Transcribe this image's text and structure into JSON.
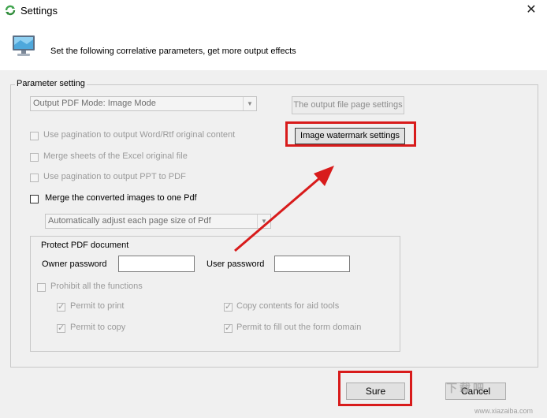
{
  "window": {
    "title": "Settings",
    "close_glyph": "✕"
  },
  "header": {
    "text": "Set the following correlative parameters, get more output effects"
  },
  "parameter_group": {
    "label": "Parameter setting",
    "output_mode": "Output PDF Mode: Image Mode",
    "output_page_settings_btn": "The output file page settings",
    "image_watermark_btn": "Image watermark settings",
    "options": {
      "word_pagination": "Use pagination to output Word/Rtf original content",
      "excel_merge": "Merge sheets of the Excel original file",
      "ppt_pagination": "Use pagination to output PPT to PDF",
      "merge_images": "Merge the converted images to one Pdf"
    },
    "page_size_select": "Automatically adjust each page size of Pdf"
  },
  "protect_group": {
    "label": "Protect PDF document",
    "owner_password_label": "Owner password",
    "user_password_label": "User password",
    "prohibit_all": "Prohibit all the functions",
    "permit_print": "Permit to print",
    "permit_copy": "Permit to copy",
    "copy_contents": "Copy contents for aid tools",
    "permit_fill": "Permit to fill out the form domain"
  },
  "footer": {
    "sure_label": "Sure",
    "cancel_label": "Cancel"
  },
  "watermark": {
    "logo_text": "下载吧",
    "site": "www.xiazaiba.com"
  },
  "colors": {
    "highlight": "#d81b1b",
    "disabled_text": "#9a9a9a"
  }
}
